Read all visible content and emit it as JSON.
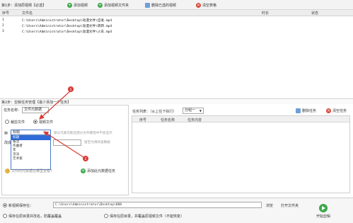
{
  "toolbar": {
    "step_label": "第1步：添加原视频【必选】",
    "add_video": "添加视频",
    "add_folder": "添加视频文件夹",
    "delete_selected": "删除已选的视频",
    "clear_table": "清空表格"
  },
  "file_list": {
    "columns": [
      "序号",
      "文件名",
      "时长",
      "状态"
    ],
    "rows": [
      {
        "index": "1",
        "path": "C:\\Users\\Administrator\\Desktop\\动漫文件\\自发.mp4"
      },
      {
        "index": "2",
        "path": "C:\\Users\\Administrator\\Desktop\\动漫文件\\转转.mp4"
      },
      {
        "index": "3",
        "path": "C:\\Users\\Administrator\\Desktop\\动漫文件\\火车.mp4"
      }
    ]
  },
  "step2": {
    "title": "第2步：剪辑任务管理【最少添加一个任务】",
    "task_name_label": "任务名称：",
    "task_name_value": "文件元数据",
    "radio_crop": "裁剪文件",
    "radio_video": "视频文件",
    "field_label": "种",
    "field_value": "标题",
    "dropdown_options": [
      "标题",
      "备注",
      "作曲者",
      "年",
      "流派",
      "艺术家"
    ],
    "hint1": "部分元素可能在部分文件属性中不会显示",
    "row2_label": "改成",
    "clear_hint": "留空为清除该数据",
    "check_metadata": "文件的元数据在哪里查看?",
    "add_task": "添加此元数据任务",
    "task_list_label": "任务列表：（从上往下执行）",
    "group_select": "分组一",
    "delete_task": "删除任务",
    "clear_task": "清空任务",
    "task_columns": [
      "序号",
      "任务名称",
      "任务内容"
    ]
  },
  "bottom": {
    "new_video_save_label": "新视频保存在：",
    "save_path": "C:\\Users\\Administrator\\Desktop\\888",
    "browse": "浏览",
    "open_folder": "打开文件夹",
    "option_a": "保存在原目录并改名，防覆盖覆盖",
    "option_b": "保存在原目录，并覆盖原视频文件（不能恢复）",
    "start": "开始剪辑"
  },
  "annotations": {
    "marker_1": "1",
    "marker_2": "2"
  },
  "colors": {
    "selection": "#2f6bd8",
    "arrow": "#d93a35",
    "start_icon": "#3ea84a"
  }
}
